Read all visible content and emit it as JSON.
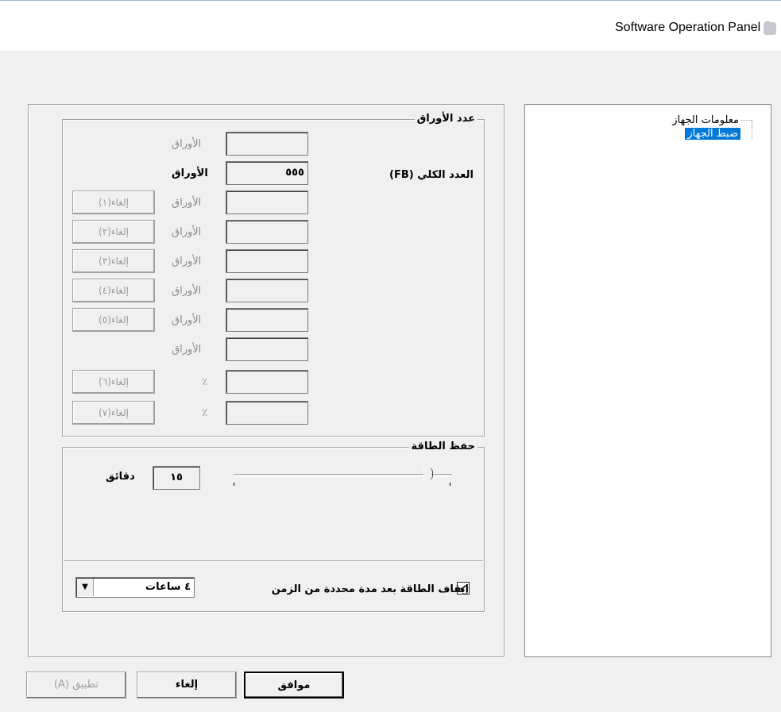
{
  "window": {
    "title": "Software Operation Panel fi-"
  },
  "tree": {
    "items": [
      {
        "label": "معلومات الجهاز"
      },
      {
        "label": "ضبط الجهاز",
        "selected": true
      }
    ]
  },
  "page_count": {
    "group_title": "عدد الأوراق",
    "total_label": "العدد الكلي (FB)",
    "rows": [
      {
        "value": "",
        "unit": "الأوراق",
        "unit_bold": false,
        "clear_label": ""
      },
      {
        "value": "٥٥٥",
        "unit": "الأوراق",
        "unit_bold": true,
        "clear_label": ""
      },
      {
        "value": "",
        "unit": "الأوراق",
        "unit_bold": false,
        "clear_label": "إلغاء(١)"
      },
      {
        "value": "",
        "unit": "الأوراق",
        "unit_bold": false,
        "clear_label": "إلغاء(٢)"
      },
      {
        "value": "",
        "unit": "الأوراق",
        "unit_bold": false,
        "clear_label": "إلغاء(٣)"
      },
      {
        "value": "",
        "unit": "الأوراق",
        "unit_bold": false,
        "clear_label": "إلغاء(٤)"
      },
      {
        "value": "",
        "unit": "الأوراق",
        "unit_bold": false,
        "clear_label": "إلغاء(٥)"
      },
      {
        "value": "",
        "unit": "الأوراق",
        "unit_bold": false,
        "clear_label": ""
      },
      {
        "value": "",
        "unit": "٪",
        "unit_bold": false,
        "clear_label": "إلغاء(٦)"
      },
      {
        "value": "",
        "unit": "٪",
        "unit_bold": false,
        "clear_label": "إلغاء(٧)"
      }
    ]
  },
  "power_save": {
    "group_title": "حفظ الطاقة",
    "minutes_value": "١٥",
    "minutes_label": "دقائق",
    "auto_off_checked": true,
    "auto_off_check_glyph": "✔",
    "auto_off_label": "إيقاف الطاقة بعد مدة محددة من الزمن",
    "auto_off_selected": "٤ ساعات",
    "dropdown_arrow": "▼"
  },
  "buttons": {
    "ok": "موافق",
    "cancel": "إلغاء",
    "apply": "تطبيق (A)"
  }
}
